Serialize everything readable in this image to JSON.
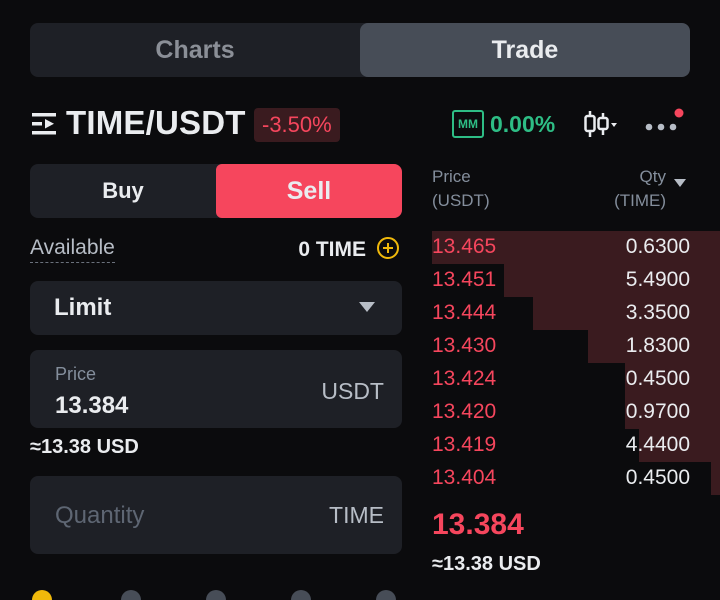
{
  "tabs": [
    {
      "label": "Charts",
      "active": false
    },
    {
      "label": "Trade",
      "active": true
    }
  ],
  "header": {
    "pair": "TIME/USDT",
    "change": "-3.50%",
    "mm_label": "MM",
    "mm_value": "0.00%",
    "icons": [
      "menu-icon",
      "candlestick-icon",
      "more-icon"
    ]
  },
  "form": {
    "buy_label": "Buy",
    "sell_label": "Sell",
    "available_label": "Available",
    "available_value": "0 TIME",
    "order_type": "Limit",
    "price_label": "Price",
    "price_value": "13.384",
    "price_unit": "USDT",
    "price_usd": "≈13.38 USD",
    "quantity_placeholder": "Quantity",
    "quantity_unit": "TIME"
  },
  "orderbook": {
    "price_header": "Price\n(USDT)",
    "qty_header": "Qty\n(TIME)",
    "asks": [
      {
        "price": "13.465",
        "qty": "0.6300",
        "depth": 1.0
      },
      {
        "price": "13.451",
        "qty": "5.4900",
        "depth": 0.75
      },
      {
        "price": "13.444",
        "qty": "3.3500",
        "depth": 0.65
      },
      {
        "price": "13.430",
        "qty": "1.8300",
        "depth": 0.46
      },
      {
        "price": "13.424",
        "qty": "0.4500",
        "depth": 0.33
      },
      {
        "price": "13.420",
        "qty": "0.9700",
        "depth": 0.33
      },
      {
        "price": "13.419",
        "qty": "4.4400",
        "depth": 0.28
      },
      {
        "price": "13.404",
        "qty": "0.4500",
        "depth": 0.03
      }
    ],
    "last_price": "13.384",
    "last_usd": "≈13.38 USD"
  },
  "colors": {
    "sell": "#f6465d",
    "buy_green": "#2ebd85",
    "panel": "#1e2026"
  }
}
